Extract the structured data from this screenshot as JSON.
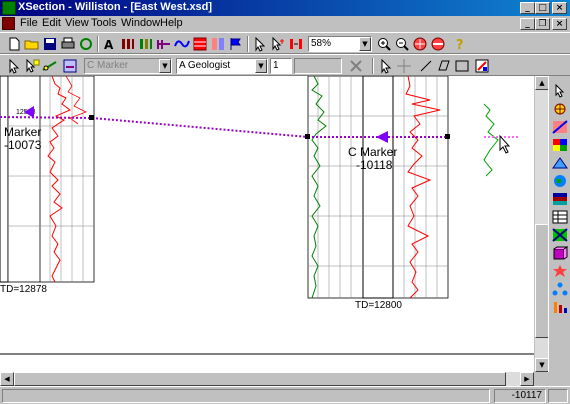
{
  "window": {
    "title": "XSection - Williston - [East West.xsd]",
    "controls": {
      "minimize": "_",
      "maximize": "□",
      "close": "×"
    },
    "mdi_controls": {
      "minimize": "_",
      "restore": "❐",
      "close": "×"
    }
  },
  "menu": {
    "items": [
      {
        "label": "File"
      },
      {
        "label": "Edit"
      },
      {
        "label": "View"
      },
      {
        "label": "Tools"
      },
      {
        "label": "Window"
      },
      {
        "label": "Help"
      }
    ]
  },
  "toolbar1": {
    "zoom": "58%"
  },
  "toolbar2": {
    "marker_select": "C Marker",
    "geologist_select": "A Geologist",
    "number_field": "1"
  },
  "canvas": {
    "left_well_marker": {
      "line1": "Marker",
      "line2": "-10073"
    },
    "right_well_marker": {
      "line1": "C Marker",
      "line2": "-10118"
    },
    "left_well_td": "TD=12878",
    "right_well_td": "TD=12800",
    "left_well_top_depth": "12538"
  },
  "statusbar": {
    "value": "-10117"
  },
  "colors": {
    "titlebar": "#000080",
    "marker_line": "#9900cc",
    "gamma_ray": "#008000",
    "resistivity": "#ff0000",
    "marker_flag": "#8000ff"
  }
}
